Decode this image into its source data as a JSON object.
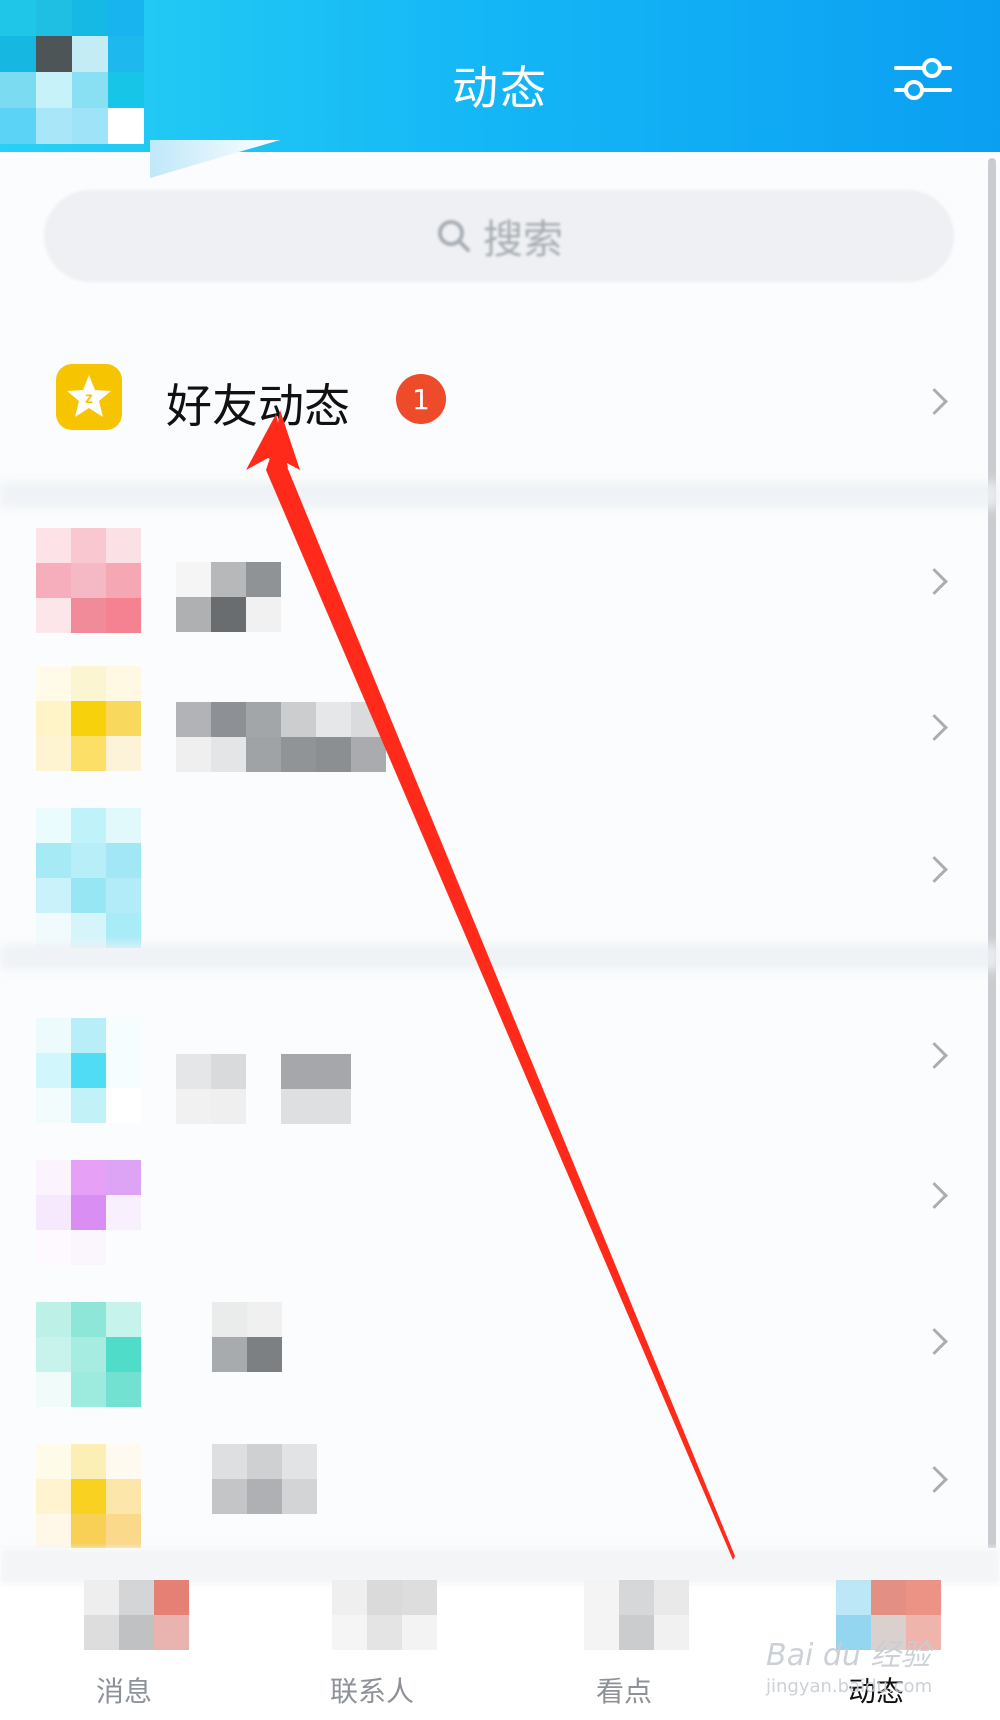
{
  "header": {
    "title": "动态",
    "settings_icon": "settings-sliders-icon"
  },
  "search": {
    "placeholder": "搜索",
    "icon": "search-icon"
  },
  "friend_feed": {
    "label": "好友动态",
    "badge_count": "1",
    "icon": "qzone-star-icon"
  },
  "tabs": [
    {
      "label": "消息",
      "active": false
    },
    {
      "label": "联系人",
      "active": false
    },
    {
      "label": "看点",
      "active": false
    },
    {
      "label": "动态",
      "active": true
    }
  ],
  "watermark": {
    "brand": "Bai du 经验",
    "url": "jingyan.baidu.com"
  },
  "colors": {
    "header_start": "#27d1f3",
    "header_end": "#0b9ff2",
    "badge": "#ee4b2b",
    "feed_icon": "#f6c400",
    "annotation_arrow": "#ff2a1a"
  }
}
